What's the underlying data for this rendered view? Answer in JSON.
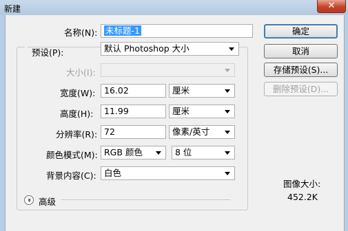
{
  "window": {
    "title": "新建",
    "close_glyph": "✕"
  },
  "name": {
    "label": "名称(N):",
    "value": "未标题-1"
  },
  "preset": {
    "label": "预设(P):",
    "value": "默认 Photoshop 大小"
  },
  "size": {
    "label": "大小(I):",
    "value": ""
  },
  "width": {
    "label": "宽度(W):",
    "value": "16.02",
    "unit": "厘米"
  },
  "height": {
    "label": "高度(H):",
    "value": "11.99",
    "unit": "厘米"
  },
  "resolution": {
    "label": "分辨率(R):",
    "value": "72",
    "unit": "像素/英寸"
  },
  "color_mode": {
    "label": "颜色模式(M):",
    "mode": "RGB 颜色",
    "depth": "8 位"
  },
  "background": {
    "label": "背景内容(C):",
    "value": "白色"
  },
  "advanced": {
    "label": "高级",
    "icon": "chevron-down-icon",
    "glyph": "»"
  },
  "buttons": {
    "ok": "确定",
    "cancel": "取消",
    "save_preset": "存储预设(S)...",
    "delete_preset": "删除预设(D)..."
  },
  "image_size": {
    "label": "图像大小:",
    "value": "452.2K"
  },
  "colors": {
    "selection": "#3399ff",
    "default_border": "#3c7fb1",
    "close": "#c4432a"
  }
}
